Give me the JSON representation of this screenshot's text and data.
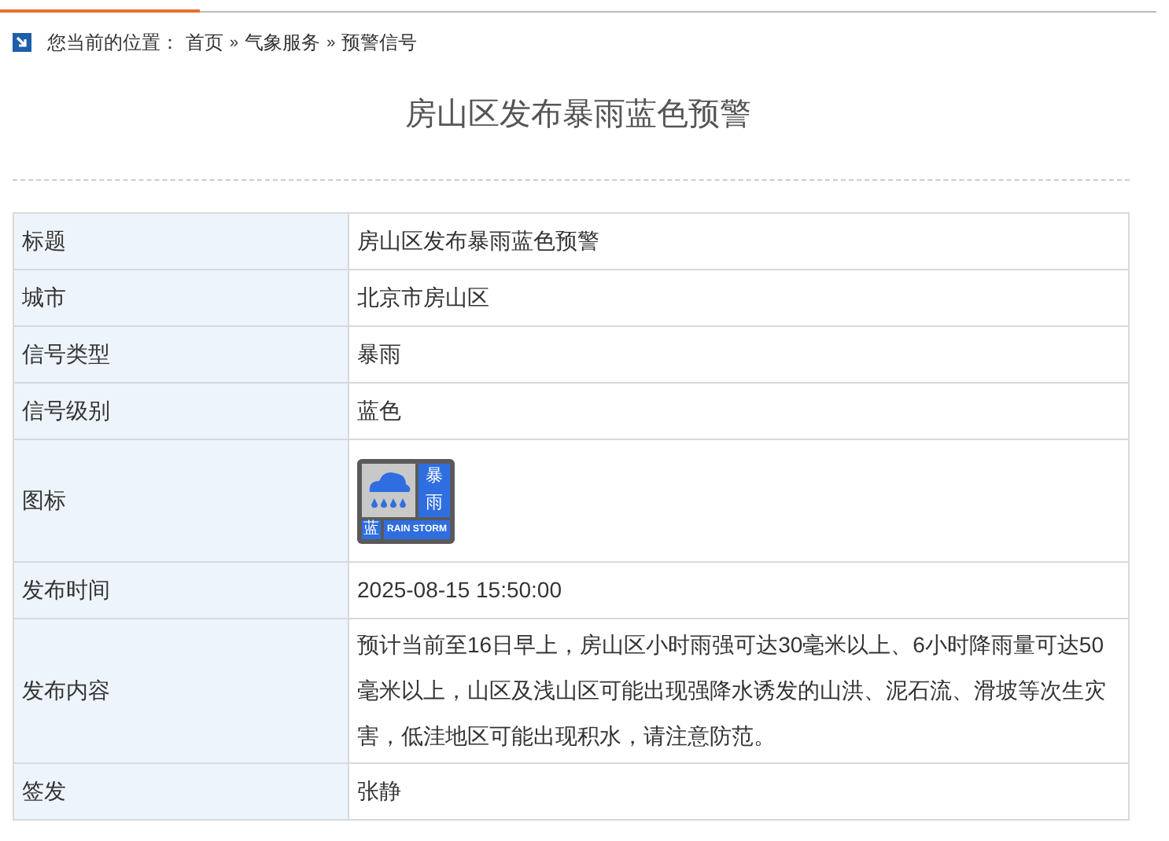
{
  "breadcrumb": {
    "prefix": "您当前的位置：",
    "items": [
      "首页",
      "气象服务",
      "预警信号"
    ],
    "separator": "»"
  },
  "title": "房山区发布暴雨蓝色预警",
  "rows": [
    {
      "kind": "text",
      "label": "标题",
      "value": "房山区发布暴雨蓝色预警"
    },
    {
      "kind": "text",
      "label": "城市",
      "value": "北京市房山区"
    },
    {
      "kind": "text",
      "label": "信号类型",
      "value": "暴雨"
    },
    {
      "kind": "text",
      "label": "信号级别",
      "value": "蓝色"
    },
    {
      "kind": "icon",
      "label": "图标",
      "icon": {
        "char_top": "暴",
        "char_bottom": "雨",
        "level_char": "蓝",
        "caption": "RAIN STORM",
        "color": "#2f6ee0"
      }
    },
    {
      "kind": "text",
      "label": "发布时间",
      "value": "2025-08-15 15:50:00"
    },
    {
      "kind": "text",
      "label": "发布内容",
      "value": "预计当前至16日早上，房山区小时雨强可达30毫米以上、6小时降雨量可达50毫米以上，山区及浅山区可能出现强降水诱发的山洪、泥石流、滑坡等次生灾害，低洼地区可能出现积水，请注意防范。"
    },
    {
      "kind": "text",
      "label": "签发",
      "value": "张静"
    }
  ]
}
